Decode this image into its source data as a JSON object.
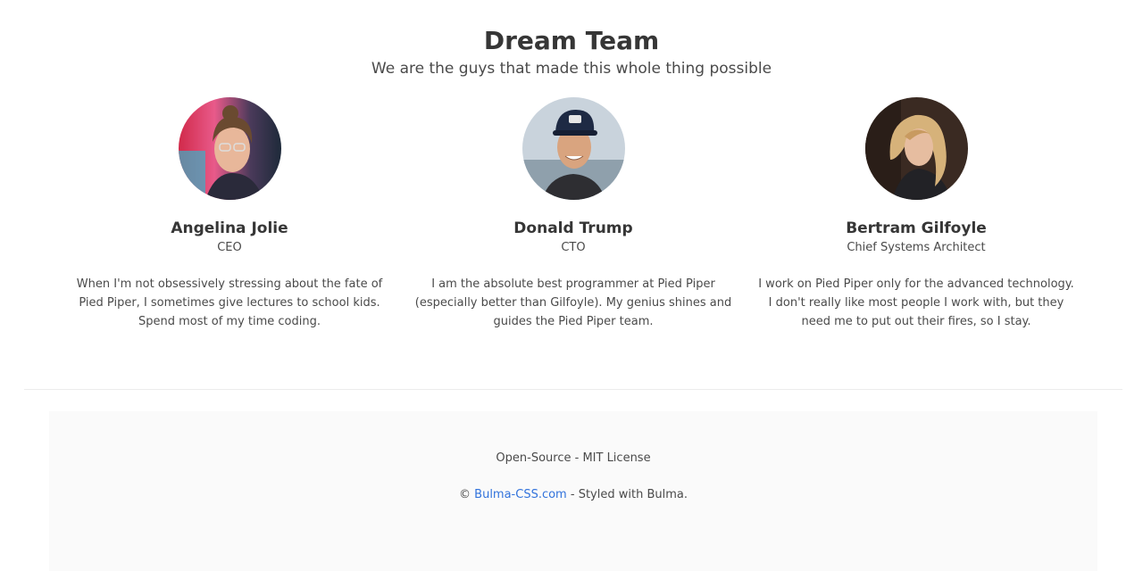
{
  "hero": {
    "title": "Dream Team",
    "subtitle": "We are the guys that made this whole thing possible"
  },
  "team": [
    {
      "name": "Angelina Jolie",
      "role": "CEO",
      "bio": "When I'm not obsessively stressing about the fate of Pied Piper, I sometimes give lectures to school kids. Spend most of my time coding."
    },
    {
      "name": "Donald Trump",
      "role": "CTO",
      "bio": "I am the absolute best programmer at Pied Piper (especially better than Gilfoyle). My genius shines and guides the Pied Piper team."
    },
    {
      "name": "Bertram Gilfoyle",
      "role": "Chief Systems Architect",
      "bio": "I work on Pied Piper only for the advanced technology. I don't really like most people I work with, but they need me to put out their fires, so I stay."
    }
  ],
  "footer": {
    "license": "Open-Source - MIT License",
    "copyright_symbol": "©",
    "link_text": "Bulma-CSS.com",
    "credit_suffix": " - Styled with Bulma."
  },
  "colors": {
    "link": "#3273dc",
    "heading": "#363636",
    "text": "#4a4a4a",
    "footer_bg": "#fafafa"
  }
}
